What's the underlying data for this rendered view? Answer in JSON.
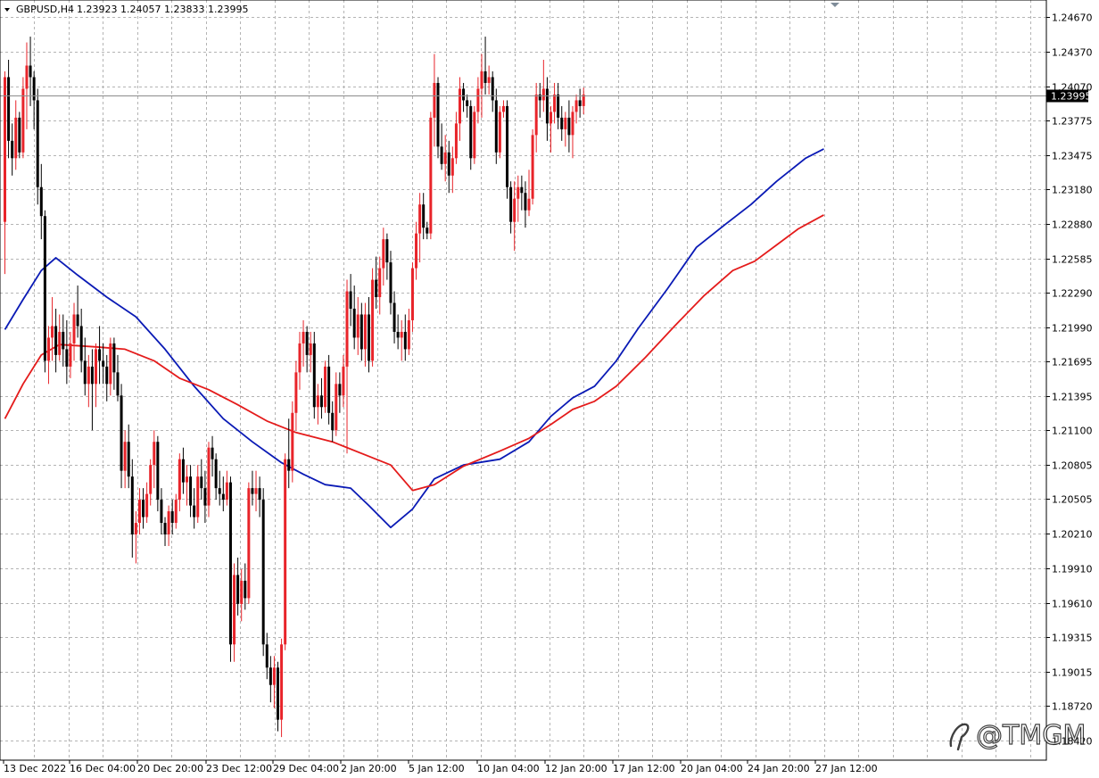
{
  "header": {
    "symbol_label": "GBPUSD,H4",
    "ohlc_label": "1.23923 1.24057 1.23833 1.23995"
  },
  "watermark": {
    "text": "@TMGM"
  },
  "colors": {
    "background": "#ffffff",
    "grid": "#b4b4b4",
    "bull_candle": "#e8242a",
    "bear_candle": "#000000",
    "ma_fast": "#0a1ab5",
    "ma_slow": "#e41b1b",
    "price_line": "#8c8c8c",
    "price_tag_bg": "#000000",
    "price_tag_text": "#ffffff"
  },
  "chart_data": {
    "type": "candlestick",
    "symbol": "GBPUSD",
    "timeframe": "H4",
    "current_price": 1.23995,
    "ylim": [
      1.1842,
      1.2467
    ],
    "y_ticks": [
      "1.24670",
      "1.24370",
      "1.24070",
      "1.23775",
      "1.23475",
      "1.23180",
      "1.22880",
      "1.22585",
      "1.22290",
      "1.21990",
      "1.21695",
      "1.21395",
      "1.21100",
      "1.20805",
      "1.20505",
      "1.20210",
      "1.19910",
      "1.19610",
      "1.19315",
      "1.19015",
      "1.18720",
      "1.18420"
    ],
    "x_ticks": [
      "13 Dec 2022",
      "16 Dec 04:00",
      "20 Dec 20:00",
      "23 Dec 12:00",
      "29 Dec 04:00",
      "2 Jan 20:00",
      "5 Jan 12:00",
      "10 Jan 04:00",
      "12 Jan 20:00",
      "17 Jan 12:00",
      "20 Jan 04:00",
      "24 Jan 20:00",
      "27 Jan 12:00"
    ],
    "bars": [
      [
        1.229,
        1.242,
        1.2245,
        1.2415
      ],
      [
        1.2415,
        1.243,
        1.2345,
        1.236
      ],
      [
        1.236,
        1.2375,
        1.233,
        1.2345
      ],
      [
        1.2345,
        1.2395,
        1.2335,
        1.238
      ],
      [
        1.238,
        1.2385,
        1.2345,
        1.235
      ],
      [
        1.235,
        1.2415,
        1.2345,
        1.2405
      ],
      [
        1.2405,
        1.2445,
        1.237,
        1.2425
      ],
      [
        1.2425,
        1.245,
        1.239,
        1.2415
      ],
      [
        1.2415,
        1.242,
        1.237,
        1.2395
      ],
      [
        1.2395,
        1.2405,
        1.2305,
        1.232
      ],
      [
        1.232,
        1.234,
        1.2275,
        1.2295
      ],
      [
        1.2295,
        1.23,
        1.216,
        1.217
      ],
      [
        1.217,
        1.22,
        1.215,
        1.219
      ],
      [
        1.219,
        1.2225,
        1.217,
        1.22
      ],
      [
        1.22,
        1.2215,
        1.216,
        1.2175
      ],
      [
        1.2175,
        1.221,
        1.217,
        1.2195
      ],
      [
        1.2195,
        1.221,
        1.2165,
        1.218
      ],
      [
        1.218,
        1.2205,
        1.215,
        1.2165
      ],
      [
        1.2165,
        1.2195,
        1.2155,
        1.2185
      ],
      [
        1.2185,
        1.222,
        1.217,
        1.221
      ],
      [
        1.221,
        1.2235,
        1.219,
        1.22
      ],
      [
        1.22,
        1.2215,
        1.216,
        1.217
      ],
      [
        1.217,
        1.219,
        1.214,
        1.215
      ],
      [
        1.215,
        1.2175,
        1.213,
        1.2165
      ],
      [
        1.2165,
        1.218,
        1.211,
        1.215
      ],
      [
        1.215,
        1.2185,
        1.213,
        1.218
      ],
      [
        1.218,
        1.22,
        1.215,
        1.217
      ],
      [
        1.217,
        1.2185,
        1.215,
        1.2165
      ],
      [
        1.2165,
        1.2175,
        1.2135,
        1.215
      ],
      [
        1.215,
        1.219,
        1.214,
        1.2185
      ],
      [
        1.2185,
        1.219,
        1.2145,
        1.216
      ],
      [
        1.216,
        1.2175,
        1.2135,
        1.214
      ],
      [
        1.214,
        1.215,
        1.206,
        1.2075
      ],
      [
        1.2075,
        1.211,
        1.206,
        1.21
      ],
      [
        1.21,
        1.2115,
        1.206,
        1.207
      ],
      [
        1.207,
        1.2085,
        1.2,
        1.202
      ],
      [
        1.202,
        1.204,
        1.1995,
        1.203
      ],
      [
        1.203,
        1.206,
        1.202,
        1.205
      ],
      [
        1.205,
        1.206,
        1.2025,
        1.2035
      ],
      [
        1.2035,
        1.2065,
        1.203,
        1.2055
      ],
      [
        1.2055,
        1.2085,
        1.2045,
        1.208
      ],
      [
        1.208,
        1.211,
        1.206,
        1.21
      ],
      [
        1.21,
        1.2105,
        1.204,
        1.205
      ],
      [
        1.205,
        1.206,
        1.202,
        1.203
      ],
      [
        1.203,
        1.2035,
        1.201,
        1.202
      ],
      [
        1.202,
        1.2045,
        1.201,
        1.204
      ],
      [
        1.204,
        1.205,
        1.202,
        1.203
      ],
      [
        1.203,
        1.2055,
        1.2025,
        1.205
      ],
      [
        1.205,
        1.209,
        1.204,
        1.2085
      ],
      [
        1.2085,
        1.2095,
        1.2055,
        1.2065
      ],
      [
        1.2065,
        1.208,
        1.2045,
        1.207
      ],
      [
        1.207,
        1.208,
        1.2035,
        1.2045
      ],
      [
        1.2045,
        1.206,
        1.2025,
        1.2035
      ],
      [
        1.2035,
        1.208,
        1.203,
        1.207
      ],
      [
        1.207,
        1.2085,
        1.205,
        1.206
      ],
      [
        1.206,
        1.2075,
        1.203,
        1.2045
      ],
      [
        1.2045,
        1.21,
        1.2035,
        1.2095
      ],
      [
        1.2095,
        1.2105,
        1.207,
        1.2085
      ],
      [
        1.2085,
        1.209,
        1.205,
        1.206
      ],
      [
        1.206,
        1.2075,
        1.2045,
        1.2055
      ],
      [
        1.2055,
        1.207,
        1.204,
        1.205
      ],
      [
        1.205,
        1.2075,
        1.2045,
        1.2065
      ],
      [
        1.2065,
        1.207,
        1.191,
        1.1925
      ],
      [
        1.1925,
        1.1995,
        1.191,
        1.1985
      ],
      [
        1.1985,
        1.2,
        1.195,
        1.196
      ],
      [
        1.196,
        1.199,
        1.1945,
        1.198
      ],
      [
        1.198,
        1.1995,
        1.1955,
        1.1965
      ],
      [
        1.1965,
        1.2065,
        1.196,
        1.206
      ],
      [
        1.206,
        1.2075,
        1.2045,
        1.2055
      ],
      [
        1.2055,
        1.2075,
        1.204,
        1.206
      ],
      [
        1.206,
        1.207,
        1.2035,
        1.205
      ],
      [
        1.205,
        1.206,
        1.1915,
        1.1925
      ],
      [
        1.1925,
        1.1935,
        1.1895,
        1.1905
      ],
      [
        1.1905,
        1.1915,
        1.1875,
        1.189
      ],
      [
        1.189,
        1.1915,
        1.187,
        1.1905
      ],
      [
        1.1905,
        1.191,
        1.185,
        1.186
      ],
      [
        1.186,
        1.193,
        1.1845,
        1.1925
      ],
      [
        1.1925,
        1.209,
        1.192,
        1.2085
      ],
      [
        1.2085,
        1.212,
        1.206,
        1.2075
      ],
      [
        1.2075,
        1.2135,
        1.2065,
        1.2125
      ],
      [
        1.2125,
        1.217,
        1.211,
        1.216
      ],
      [
        1.216,
        1.2195,
        1.2145,
        1.2185
      ],
      [
        1.2185,
        1.2205,
        1.2165,
        1.2195
      ],
      [
        1.2195,
        1.22,
        1.216,
        1.2175
      ],
      [
        1.2175,
        1.2195,
        1.216,
        1.2185
      ],
      [
        1.2185,
        1.2195,
        1.212,
        1.213
      ],
      [
        1.213,
        1.215,
        1.2115,
        1.214
      ],
      [
        1.214,
        1.2155,
        1.212,
        1.213
      ],
      [
        1.213,
        1.217,
        1.2125,
        1.2165
      ],
      [
        1.2165,
        1.2175,
        1.2115,
        1.2125
      ],
      [
        1.2125,
        1.2135,
        1.21,
        1.211
      ],
      [
        1.211,
        1.216,
        1.2105,
        1.215
      ],
      [
        1.215,
        1.216,
        1.2125,
        1.214
      ],
      [
        1.214,
        1.2175,
        1.213,
        1.2165
      ],
      [
        1.2165,
        1.224,
        1.209,
        1.223
      ],
      [
        1.223,
        1.2245,
        1.22,
        1.2215
      ],
      [
        1.2215,
        1.2235,
        1.218,
        1.219
      ],
      [
        1.219,
        1.2225,
        1.2175,
        1.221
      ],
      [
        1.221,
        1.222,
        1.217,
        1.218
      ],
      [
        1.218,
        1.222,
        1.2165,
        1.221
      ],
      [
        1.221,
        1.2225,
        1.216,
        1.217
      ],
      [
        1.217,
        1.225,
        1.2165,
        1.224
      ],
      [
        1.224,
        1.226,
        1.2215,
        1.2225
      ],
      [
        1.2225,
        1.226,
        1.221,
        1.225
      ],
      [
        1.225,
        1.2285,
        1.2235,
        1.2275
      ],
      [
        1.2275,
        1.228,
        1.224,
        1.2255
      ],
      [
        1.2255,
        1.2265,
        1.221,
        1.222
      ],
      [
        1.222,
        1.223,
        1.2185,
        1.2195
      ],
      [
        1.2195,
        1.221,
        1.218,
        1.219
      ],
      [
        1.219,
        1.2205,
        1.217,
        1.2195
      ],
      [
        1.2195,
        1.221,
        1.217,
        1.218
      ],
      [
        1.218,
        1.2215,
        1.2175,
        1.2205
      ],
      [
        1.2205,
        1.2255,
        1.2195,
        1.225
      ],
      [
        1.225,
        1.229,
        1.224,
        1.228
      ],
      [
        1.228,
        1.2315,
        1.2255,
        1.2305
      ],
      [
        1.2305,
        1.2315,
        1.2275,
        1.2285
      ],
      [
        1.2285,
        1.229,
        1.2275,
        1.228
      ],
      [
        1.228,
        1.2385,
        1.2275,
        1.238
      ],
      [
        1.238,
        1.2435,
        1.2355,
        1.241
      ],
      [
        1.241,
        1.2415,
        1.2345,
        1.2355
      ],
      [
        1.2355,
        1.2375,
        1.2335,
        1.234
      ],
      [
        1.234,
        1.2365,
        1.2325,
        1.235
      ],
      [
        1.235,
        1.236,
        1.2315,
        1.233
      ],
      [
        1.233,
        1.2355,
        1.2315,
        1.2345
      ],
      [
        1.2345,
        1.2385,
        1.234,
        1.2375
      ],
      [
        1.2375,
        1.2415,
        1.236,
        1.2405
      ],
      [
        1.2405,
        1.241,
        1.2385,
        1.2395
      ],
      [
        1.2395,
        1.24,
        1.238,
        1.239
      ],
      [
        1.239,
        1.2395,
        1.2335,
        1.2345
      ],
      [
        1.2345,
        1.239,
        1.234,
        1.2385
      ],
      [
        1.2385,
        1.2415,
        1.2375,
        1.2405
      ],
      [
        1.2405,
        1.2435,
        1.238,
        1.242
      ],
      [
        1.242,
        1.245,
        1.24,
        1.241
      ],
      [
        1.241,
        1.2425,
        1.24,
        1.2415
      ],
      [
        1.2415,
        1.242,
        1.2385,
        1.2395
      ],
      [
        1.2395,
        1.2405,
        1.234,
        1.235
      ],
      [
        1.235,
        1.239,
        1.2345,
        1.2385
      ],
      [
        1.2385,
        1.2395,
        1.238,
        1.239
      ],
      [
        1.239,
        1.2395,
        1.231,
        1.232
      ],
      [
        1.232,
        1.2325,
        1.228,
        1.229
      ],
      [
        1.229,
        1.2325,
        1.2265,
        1.231
      ],
      [
        1.231,
        1.233,
        1.229,
        1.232
      ],
      [
        1.232,
        1.233,
        1.23,
        1.2315
      ],
      [
        1.2315,
        1.2325,
        1.2285,
        1.23
      ],
      [
        1.23,
        1.2335,
        1.2295,
        1.231
      ],
      [
        1.231,
        1.237,
        1.2305,
        1.2365
      ],
      [
        1.2365,
        1.241,
        1.235,
        1.24
      ],
      [
        1.24,
        1.241,
        1.238,
        1.2395
      ],
      [
        1.2395,
        1.243,
        1.2385,
        1.2405
      ],
      [
        1.2405,
        1.2415,
        1.236,
        1.2375
      ],
      [
        1.2375,
        1.239,
        1.235,
        1.2385
      ],
      [
        1.2385,
        1.241,
        1.2375,
        1.24
      ],
      [
        1.24,
        1.241,
        1.237,
        1.238
      ],
      [
        1.238,
        1.239,
        1.236,
        1.237
      ],
      [
        1.237,
        1.2385,
        1.2355,
        1.238
      ],
      [
        1.238,
        1.2395,
        1.235,
        1.2365
      ],
      [
        1.2365,
        1.239,
        1.2345,
        1.2385
      ],
      [
        1.2385,
        1.24,
        1.2375,
        1.2395
      ],
      [
        1.2395,
        1.2405,
        1.238,
        1.239
      ],
      [
        1.239,
        1.2406,
        1.2383,
        1.24
      ]
    ],
    "moving_averages": [
      {
        "color": "#0a1ab5",
        "points": [
          [
            0,
            1.2197
          ],
          [
            5,
            1.2223
          ],
          [
            10,
            1.2248
          ],
          [
            14,
            1.2259
          ],
          [
            20,
            1.2244
          ],
          [
            28,
            1.2225
          ],
          [
            36,
            1.2208
          ],
          [
            44,
            1.218
          ],
          [
            52,
            1.2148
          ],
          [
            60,
            1.212
          ],
          [
            68,
            1.21
          ],
          [
            76,
            1.2082
          ],
          [
            82,
            1.2072
          ],
          [
            88,
            1.2063
          ],
          [
            95,
            1.206
          ],
          [
            100,
            1.2045
          ],
          [
            106,
            1.2026
          ],
          [
            112,
            1.2042
          ],
          [
            118,
            1.2068
          ],
          [
            126,
            1.208
          ],
          [
            136,
            1.2085
          ],
          [
            144,
            1.21
          ],
          [
            150,
            1.2122
          ],
          [
            156,
            1.2138
          ],
          [
            162,
            1.2148
          ],
          [
            168,
            1.217
          ],
          [
            174,
            1.2198
          ],
          [
            182,
            1.2232
          ],
          [
            190,
            1.2268
          ],
          [
            198,
            1.2288
          ],
          [
            205,
            1.2305
          ],
          [
            212,
            1.2325
          ],
          [
            220,
            1.2345
          ],
          [
            225,
            1.2353
          ]
        ]
      },
      {
        "color": "#e41b1b",
        "points": [
          [
            0,
            1.212
          ],
          [
            5,
            1.215
          ],
          [
            10,
            1.2175
          ],
          [
            15,
            1.2184
          ],
          [
            25,
            1.2182
          ],
          [
            33,
            1.218
          ],
          [
            41,
            1.217
          ],
          [
            48,
            1.2155
          ],
          [
            56,
            1.2145
          ],
          [
            64,
            1.2132
          ],
          [
            72,
            1.2118
          ],
          [
            80,
            1.2108
          ],
          [
            90,
            1.21
          ],
          [
            98,
            1.209
          ],
          [
            106,
            1.208
          ],
          [
            112,
            1.2058
          ],
          [
            118,
            1.2063
          ],
          [
            126,
            1.2079
          ],
          [
            136,
            1.2092
          ],
          [
            144,
            1.2103
          ],
          [
            150,
            1.2115
          ],
          [
            156,
            1.2128
          ],
          [
            162,
            1.2135
          ],
          [
            168,
            1.2148
          ],
          [
            176,
            1.2173
          ],
          [
            184,
            1.22
          ],
          [
            192,
            1.2226
          ],
          [
            200,
            1.2248
          ],
          [
            206,
            1.2256
          ],
          [
            212,
            1.227
          ],
          [
            218,
            1.2284
          ],
          [
            225,
            1.2296
          ]
        ]
      }
    ]
  }
}
